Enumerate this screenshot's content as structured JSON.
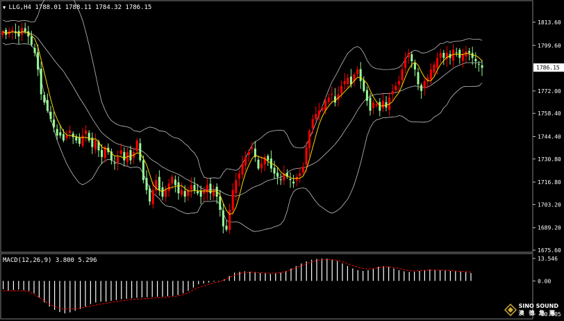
{
  "header": {
    "symbol": "LLG,H4",
    "ohlc": "1788.01 1788.11 1784.32 1786.15"
  },
  "macd": {
    "label": "MACD(12,26,9)",
    "value1": "3.800",
    "value2": "5.296",
    "ticks": [
      "13.546",
      "0.00",
      "-20.005"
    ]
  },
  "price_axis": {
    "ticks": [
      "1813.60",
      "1799.60",
      "1786.15",
      "1772.00",
      "1758.40",
      "1744.40",
      "1730.80",
      "1716.80",
      "1703.20",
      "1689.20",
      "1675.60"
    ],
    "current": "1786.15"
  },
  "logo": {
    "text": "SINO SOUND",
    "sub": "澳 德 集 團"
  },
  "colors": {
    "up": "#ff0000",
    "down": "#98fb98",
    "bands": "#c0c0c0",
    "ma": "#ffd700",
    "macd_signal": "#ff0000",
    "macd_hist": "#ffffff",
    "background": "#000000"
  },
  "chart_data": [
    {
      "type": "candlestick",
      "title": "LLG,H4",
      "ylim": [
        1675.6,
        1813.6
      ],
      "indicators": [
        "bollinger-bands",
        "moving-average"
      ],
      "close": [
        1808,
        1806,
        1808,
        1809,
        1807,
        1805,
        1810,
        1808,
        1805,
        1800,
        1795,
        1785,
        1770,
        1765,
        1760,
        1755,
        1750,
        1745,
        1745,
        1742,
        1745,
        1748,
        1744,
        1742,
        1740,
        1745,
        1748,
        1742,
        1738,
        1742,
        1736,
        1732,
        1738,
        1735,
        1730,
        1728,
        1732,
        1736,
        1730,
        1735,
        1730,
        1735,
        1742,
        1730,
        1718,
        1712,
        1705,
        1712,
        1718,
        1712,
        1708,
        1712,
        1716,
        1720,
        1715,
        1710,
        1712,
        1708,
        1712,
        1715,
        1712,
        1710,
        1708,
        1712,
        1715,
        1710,
        1712,
        1708,
        1700,
        1690,
        1688,
        1700,
        1712,
        1718,
        1722,
        1728,
        1732,
        1735,
        1738,
        1732,
        1725,
        1728,
        1732,
        1730,
        1725,
        1722,
        1720,
        1718,
        1722,
        1720,
        1718,
        1716,
        1720,
        1722,
        1726,
        1738,
        1748,
        1755,
        1758,
        1760,
        1762,
        1766,
        1768,
        1770,
        1765,
        1770,
        1775,
        1778,
        1780,
        1776,
        1782,
        1785,
        1778,
        1772,
        1766,
        1760,
        1765,
        1764,
        1760,
        1766,
        1762,
        1768,
        1772,
        1775,
        1778,
        1785,
        1792,
        1795,
        1790,
        1785,
        1776,
        1772,
        1778,
        1780,
        1785,
        1788,
        1792,
        1795,
        1792,
        1795,
        1792,
        1797,
        1795,
        1792,
        1794,
        1796,
        1795,
        1792,
        1790,
        1788,
        1786
      ]
    },
    {
      "type": "bar",
      "title": "MACD(12,26,9)",
      "ylim": [
        -20.005,
        13.546
      ],
      "series": [
        {
          "values": [
            -5,
            -5.8,
            -5.5,
            -5.2,
            -5.6,
            -6,
            -7.5,
            -10,
            -13,
            -15.5,
            -17.5,
            -18.8,
            -19.6,
            -19,
            -18,
            -17,
            -15.5,
            -14,
            -13,
            -12.5,
            -12.5,
            -12,
            -11.5,
            -11,
            -10.8,
            -10.5,
            -10.2,
            -10,
            -9.8,
            -9.7,
            -9.6,
            -9.5,
            -9.3,
            -9,
            -8.5,
            -7.5,
            -6,
            -4,
            -2,
            -1.5,
            -1,
            -0.5,
            0,
            1,
            3,
            5,
            5.5,
            5.8,
            5.5,
            5.2,
            4.8,
            4.5,
            4.2,
            4.5,
            5,
            6,
            7.5,
            9,
            10.5,
            11.8,
            12.8,
            13.3,
            13.5,
            13.4,
            13,
            12,
            10.5,
            9,
            7.5,
            6.5,
            6,
            6.5,
            7.5,
            8.5,
            9,
            8.5,
            7.5,
            6.5,
            5.8,
            5.4,
            5.5,
            6,
            6.5,
            6.8,
            6.6,
            6.4,
            6.3,
            6,
            5.8,
            5.6,
            5.3,
            4.8
          ]
        },
        {
          "values": [
            -6,
            -6,
            -6,
            -6,
            -6,
            -6.5,
            -8,
            -10,
            -12,
            -14,
            -15.5,
            -16.5,
            -17,
            -17,
            -16.8,
            -16.3,
            -15.8,
            -15.2,
            -14.6,
            -14,
            -13.5,
            -13,
            -12.5,
            -12,
            -11.6,
            -11.3,
            -11,
            -10.8,
            -10.6,
            -10.4,
            -10.2,
            -10,
            -9.8,
            -9.5,
            -9,
            -8.3,
            -7.2,
            -5.5,
            -4,
            -3,
            -2,
            -1.3,
            -0.5,
            0.5,
            2,
            3.5,
            4.5,
            5,
            5.2,
            5.2,
            5,
            4.8,
            4.6,
            4.7,
            5,
            5.7,
            6.8,
            8,
            9.2,
            10.4,
            11.5,
            12.2,
            12.7,
            12.9,
            12.8,
            12.4,
            11.6,
            10.5,
            9.3,
            8.2,
            7.5,
            7.2,
            7.4,
            8,
            8.5,
            8.5,
            8.1,
            7.5,
            6.8,
            6.2,
            6,
            6.1,
            6.4,
            6.6,
            6.6,
            6.5,
            6.4,
            6.2,
            6,
            5.8,
            5.6,
            5.3
          ]
        }
      ]
    }
  ]
}
